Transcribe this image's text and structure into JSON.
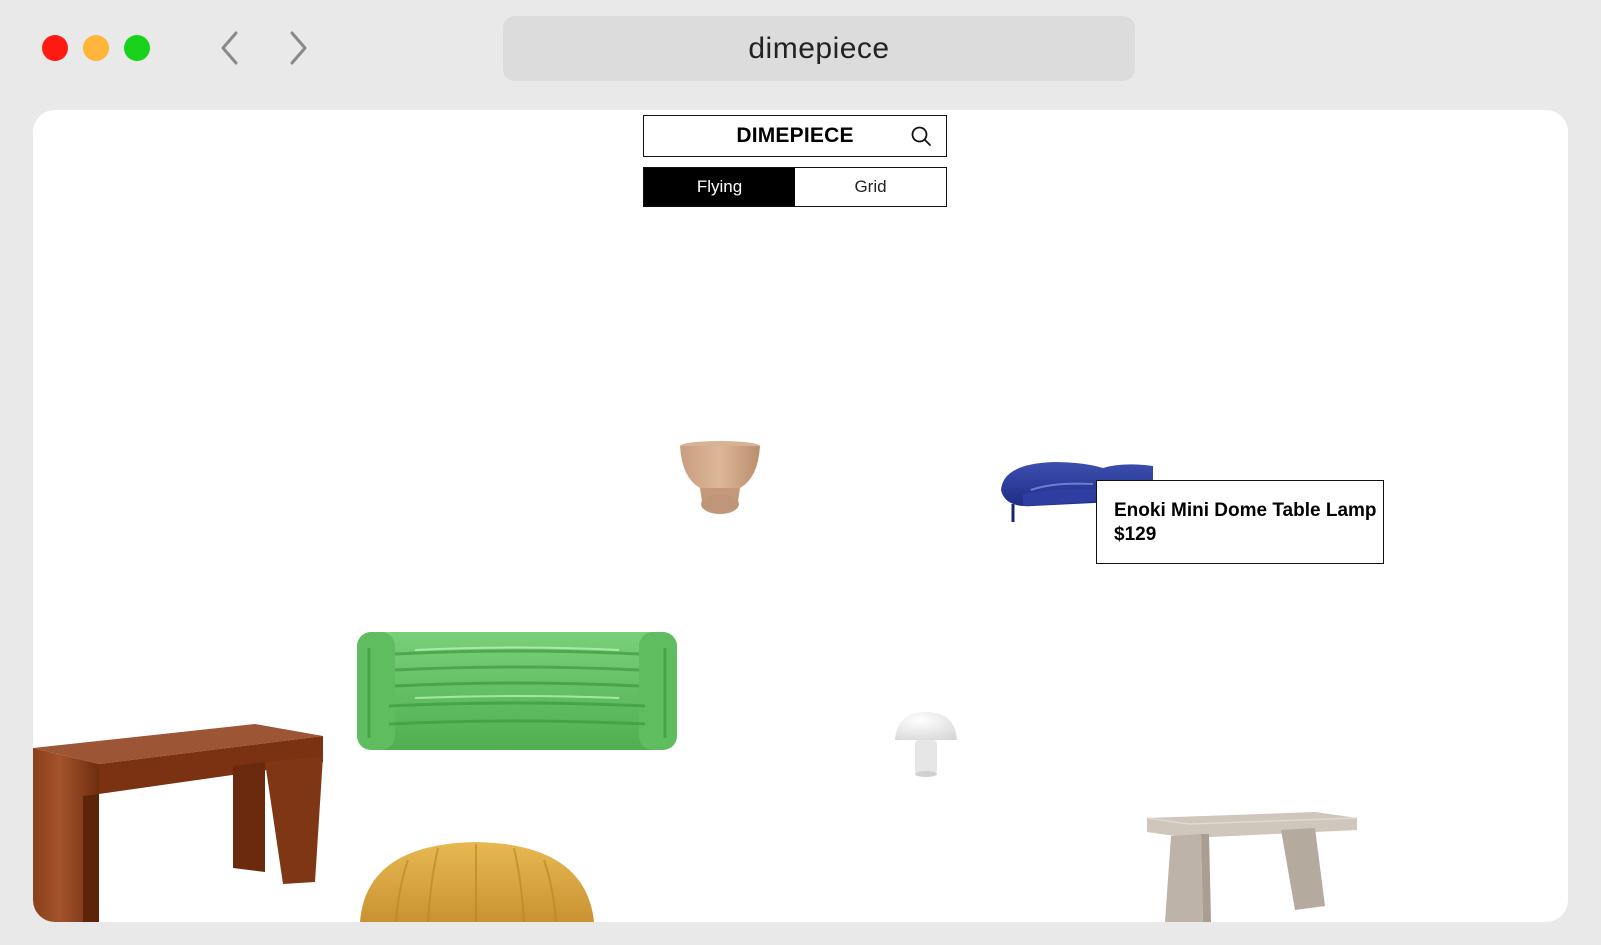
{
  "window": {
    "address": "dimepiece"
  },
  "site": {
    "brand": "DIMEPIECE",
    "view_toggle": {
      "options": [
        "Flying",
        "Grid"
      ],
      "selected": "Flying"
    }
  },
  "tooltip": {
    "name": "Enoki Mini Dome Table Lamp",
    "price": "$129"
  },
  "icons": {
    "back": "chevron-left-icon",
    "forward": "chevron-right-icon",
    "search": "search-icon"
  }
}
